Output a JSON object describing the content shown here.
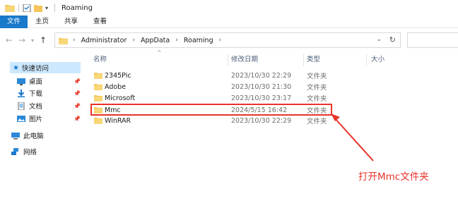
{
  "window": {
    "title": "Roaming"
  },
  "ribbon": {
    "tabs": [
      "文件",
      "主页",
      "共享",
      "查看"
    ]
  },
  "address": {
    "crumbs": [
      "Administrator",
      "AppData",
      "Roaming"
    ]
  },
  "nav": {
    "quick_access": "快速访问",
    "items": [
      {
        "label": "桌面",
        "icon": "desktop-icon"
      },
      {
        "label": "下载",
        "icon": "download-icon"
      },
      {
        "label": "文档",
        "icon": "document-icon"
      },
      {
        "label": "图片",
        "icon": "picture-icon"
      }
    ],
    "this_pc": "此电脑",
    "network": "网络"
  },
  "columns": {
    "name": "名称",
    "date": "修改日期",
    "type": "类型",
    "size": "大小"
  },
  "files": [
    {
      "name": "2345Pic",
      "date": "2023/10/30 22:29",
      "type": "文件夹"
    },
    {
      "name": "Adobe",
      "date": "2023/10/30 21:30",
      "type": "文件夹"
    },
    {
      "name": "Microsoft",
      "date": "2023/10/30 23:17",
      "type": "文件夹"
    },
    {
      "name": "Mmc",
      "date": "2024/5/15 16:42",
      "type": "文件夹"
    },
    {
      "name": "WinRAR",
      "date": "2023/10/30 22:29",
      "type": "文件夹"
    }
  ],
  "annotation": {
    "text": "打开Mmc文件夹",
    "color": "#e8332a"
  },
  "colors": {
    "accent": "#1979ca",
    "folder": "#f5c55a",
    "selection": "#cce8ff"
  }
}
